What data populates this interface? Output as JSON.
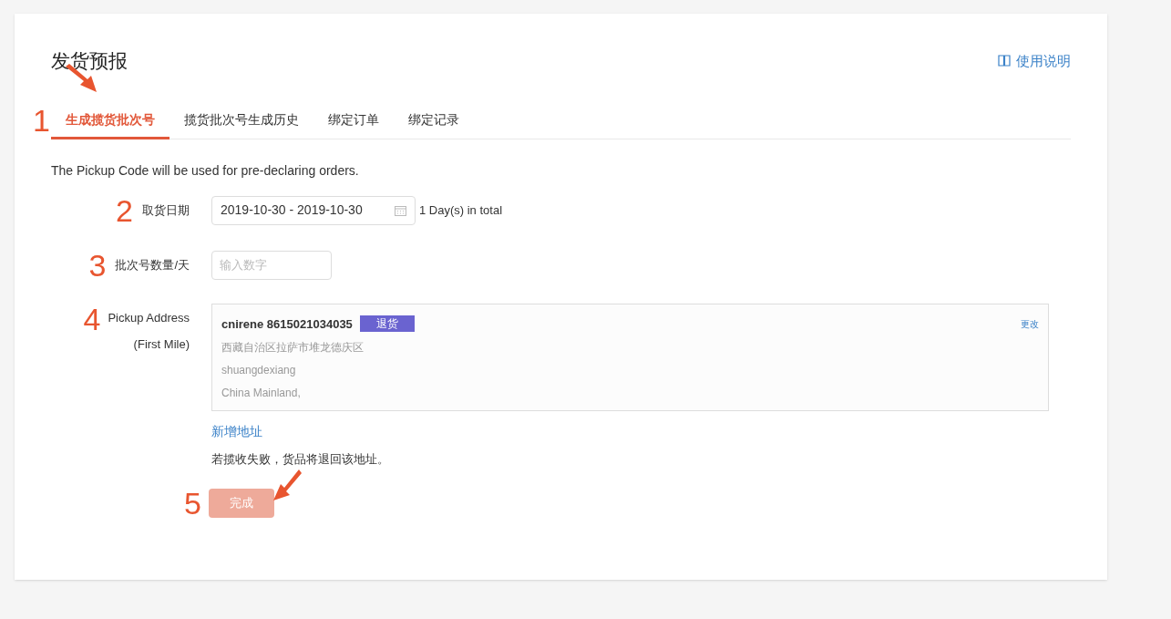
{
  "title": "发货预报",
  "help_link": "使用说明",
  "tabs": [
    {
      "label": "生成揽货批次号",
      "selected": true,
      "annotation": "1"
    },
    {
      "label": "揽货批次号生成历史",
      "selected": false
    },
    {
      "label": "绑定订单",
      "selected": false
    },
    {
      "label": "绑定记录",
      "selected": false
    }
  ],
  "description": "The Pickup Code will be used for pre-declaring orders.",
  "date_row": {
    "annotation": "2",
    "label": "取货日期",
    "value": "2019-10-30 - 2019-10-30",
    "note": "1 Day(s) in total"
  },
  "count_row": {
    "annotation": "3",
    "label": "批次号数量/天",
    "placeholder": "输入数字"
  },
  "address_row": {
    "annotation": "4",
    "label_lines": [
      "Pickup Address",
      "(First Mile)"
    ],
    "address": {
      "name": "cnirene 8615021034035",
      "tag": "退货",
      "lines": [
        "西藏自治区拉萨市堆龙德庆区",
        "shuangdexiang",
        "China Mainland,"
      ],
      "edit": "更改"
    },
    "add_link": "新增地址",
    "hint": "若揽收失败，货品将退回该地址。"
  },
  "submit": {
    "annotation": "5",
    "label": "完成",
    "disabled": true
  }
}
